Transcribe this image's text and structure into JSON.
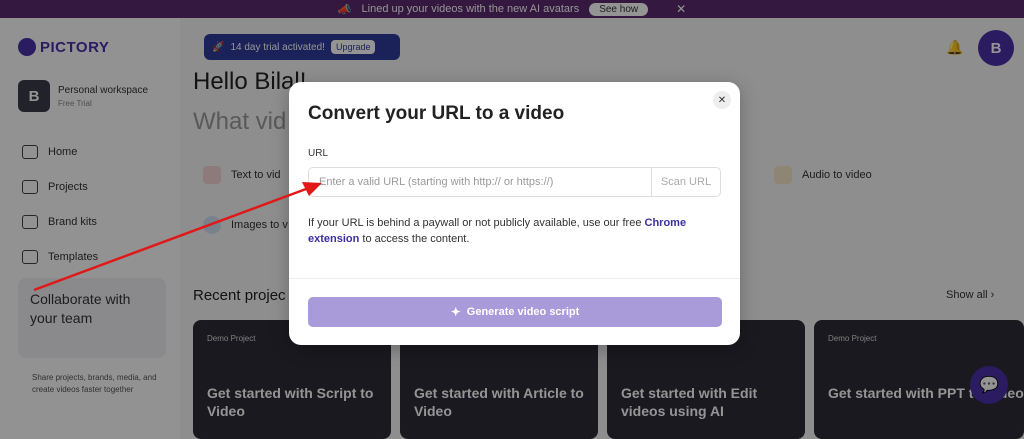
{
  "banner": {
    "text": "Lined up your videos with the new AI avatars",
    "button": "See how",
    "close": "✕"
  },
  "sidebar": {
    "logo": "PICTORY",
    "workspace": {
      "initial": "B",
      "name": "Personal workspace",
      "plan": "Free Trial"
    },
    "items": [
      {
        "label": "Home",
        "icon": "home-icon"
      },
      {
        "label": "Projects",
        "icon": "folder-icon"
      },
      {
        "label": "Brand kits",
        "icon": "briefcase-icon"
      },
      {
        "label": "Templates",
        "icon": "template-icon"
      }
    ],
    "collab": {
      "title": "Collaborate with your team",
      "desc": "Share projects, brands, media, and create videos faster together"
    }
  },
  "header": {
    "trial_text": "14 day trial activated!",
    "trial_upgrade": "Upgrade",
    "user_initial": "B"
  },
  "main": {
    "hello": "Hello Bilal!",
    "what": "What vid",
    "features": {
      "text_to_video": "Text to vid",
      "images_to_video": "Images to v",
      "audio_to_video": "Audio to video"
    },
    "recent_title": "Recent projec",
    "show_all": "Show all",
    "cards": [
      {
        "label": "Demo Project",
        "title": "Get started with Script to Video"
      },
      {
        "label": "",
        "title": "Get started with Article to Video"
      },
      {
        "label": "",
        "title": "Get started with Edit videos using AI"
      },
      {
        "label": "Demo Project",
        "title": "Get started with PPT to Video"
      }
    ]
  },
  "modal": {
    "title": "Convert your URL to a video",
    "close": "✕",
    "url_label": "URL",
    "url_placeholder": "Enter a valid URL (starting with http:// or https://)",
    "url_value": "",
    "scan_button": "Scan URL",
    "info_prefix": "If your URL is behind a paywall or not publicly available, use our free ",
    "info_link": "Chrome extension",
    "info_suffix": " to access the content.",
    "generate_button": "Generate video script"
  },
  "colors": {
    "brand": "#4a2fa8",
    "generate_button": "#a99ad9",
    "annotation_arrow": "#e01818"
  }
}
